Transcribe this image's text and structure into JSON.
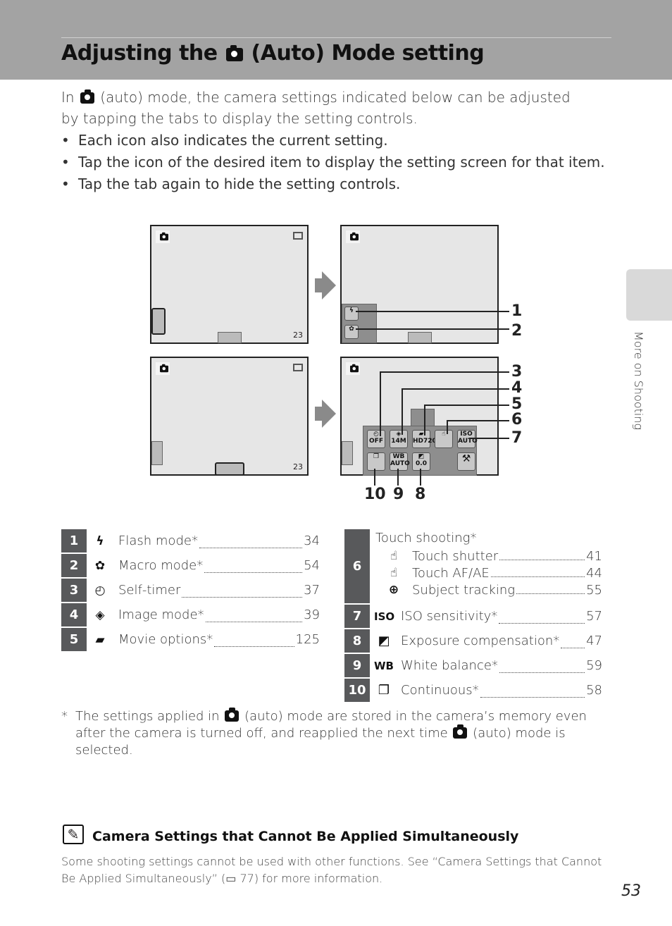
{
  "header": {
    "title_pre": "Adjusting the",
    "title_post": "(Auto) Mode setting"
  },
  "intro": {
    "pre": "In",
    "post": "(auto) mode, the camera settings indicated below can be adjusted by tapping the tabs to display the setting controls."
  },
  "bullets": [
    "Each icon also indicates the current setting.",
    "Tap the icon of the desired item to display the setting screen for that item.",
    "Tap the tab again to hide the setting controls."
  ],
  "diagram": {
    "callouts": [
      "1",
      "2",
      "3",
      "4",
      "5",
      "6",
      "7",
      "8",
      "9",
      "10"
    ],
    "screen_counter": "23",
    "icons": {
      "self_timer": "OFF",
      "image_mode": "14M",
      "movie": "HD720",
      "iso": "AUTO",
      "wb": "AUTO",
      "exposure": "0.0"
    }
  },
  "left_table": [
    {
      "num": "1",
      "icon": "flash-icon",
      "glyph": "ϟ",
      "label": "Flash mode*",
      "page": "34"
    },
    {
      "num": "2",
      "icon": "macro-icon",
      "glyph": "✿",
      "label": "Macro mode*",
      "page": "54"
    },
    {
      "num": "3",
      "icon": "self-timer-icon",
      "glyph": "◴",
      "label": "Self-timer",
      "page": "37"
    },
    {
      "num": "4",
      "icon": "image-mode-icon",
      "glyph": "◈",
      "label": "Image mode*",
      "page": "39"
    },
    {
      "num": "5",
      "icon": "movie-icon",
      "glyph": "▰",
      "label": "Movie options*",
      "page": "125"
    }
  ],
  "right_table": {
    "touch": {
      "num": "6",
      "label": "Touch shooting*",
      "items": [
        {
          "icon": "touch-shutter-icon",
          "glyph": "☝",
          "label": "Touch shutter",
          "page": "41"
        },
        {
          "icon": "touch-af-icon",
          "glyph": "☝",
          "label": "Touch AF/AE",
          "page": "44"
        },
        {
          "icon": "subject-tracking-icon",
          "glyph": "⊕",
          "label": "Subject tracking",
          "page": "55"
        }
      ]
    },
    "rows": [
      {
        "num": "7",
        "icon": "iso-icon",
        "glyph": "ISO",
        "label": "ISO sensitivity*",
        "page": "57"
      },
      {
        "num": "8",
        "icon": "exposure-icon",
        "glyph": "◩",
        "label": "Exposure compensation*",
        "page": "47"
      },
      {
        "num": "9",
        "icon": "white-balance-icon",
        "glyph": "WB",
        "label": "White balance*",
        "page": "59"
      },
      {
        "num": "10",
        "icon": "continuous-icon",
        "glyph": "❐",
        "label": "Continuous*",
        "page": "58"
      }
    ]
  },
  "footnote": {
    "mark": "*",
    "p1": "The settings applied in",
    "p2": "(auto) mode are stored in the camera’s memory even after the camera is turned off, and reapplied the next time",
    "p3": "(auto) mode is selected."
  },
  "note": {
    "title": "Camera Settings that Cannot Be Applied Simultaneously",
    "body_pre": "Some shooting settings cannot be used with other functions. See “Camera Settings that Cannot Be Applied Simultaneously” (",
    "body_ref": "77) for more information."
  },
  "side_tab": "More on Shooting",
  "page_number": "53"
}
